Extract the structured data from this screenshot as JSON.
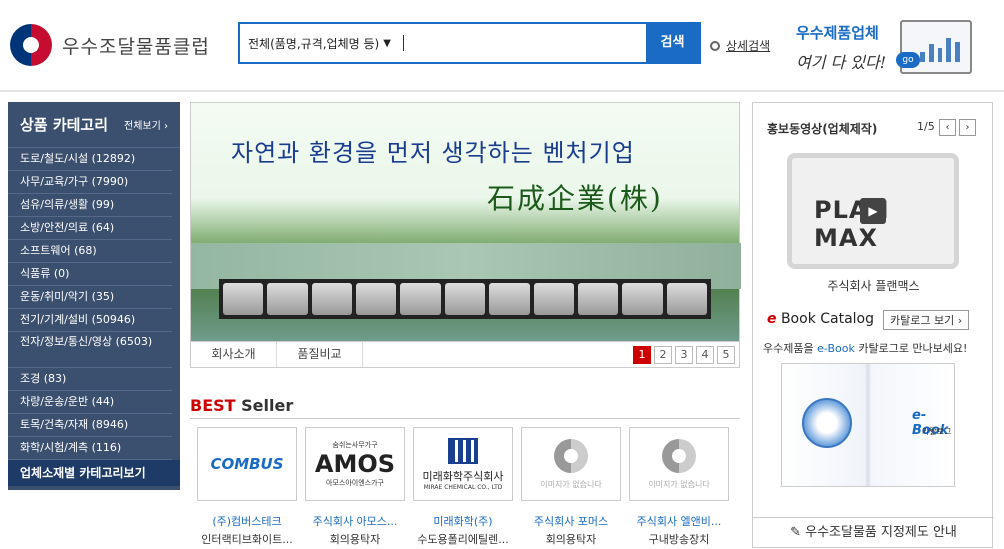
{
  "header": {
    "logo_text": "우수조달물품클럽",
    "search": {
      "scope": "전체(품명,규격,업체명 등)",
      "button": "검색",
      "advanced": "상세검색"
    },
    "promo": {
      "line1": "우수제품업체",
      "line2": "여기 다 있다!",
      "go": "go"
    }
  },
  "categories": {
    "title": "상품 카테고리",
    "view_all": "전체보기",
    "items": [
      "도로/철도/시설 (12892)",
      "사무/교육/가구 (7990)",
      "섬유/의류/생활 (99)",
      "소방/안전/의료 (64)",
      "소프트웨어 (68)",
      "식품류 (0)",
      "운동/취미/악기 (35)",
      "전기/기계/설비 (50946)",
      "전자/정보/통신/영상 (6503)",
      "조경 (83)",
      "차량/운송/운반 (44)",
      "토목/건축/자재 (8946)",
      "화학/시험/계측 (116)"
    ],
    "footer": "업체소재별 카테고리보기"
  },
  "banner": {
    "headline": "자연과 환경을 먼저 생각하는 벤처기업",
    "company": "石成企業(株)",
    "tabs": [
      "회사소개",
      "품질비교"
    ],
    "pages": [
      "1",
      "2",
      "3",
      "4",
      "5"
    ],
    "active_page": "1"
  },
  "best_seller": {
    "title_red": "BEST",
    "title_rest": " Seller",
    "items": [
      {
        "company": "(주)컴버스테크",
        "product": "인터랙티브화이트...",
        "logo": "COMBUS"
      },
      {
        "company": "주식회사 아모스...",
        "product": "회의용탁자",
        "logo": "AMOS",
        "logo_sub": "아모스아이엔스가구",
        "logo_top": "숨쉬는사무가구"
      },
      {
        "company": "미래화학(주)",
        "product": "수도용폴리에틸렌...",
        "logo": "미래화학주식회사",
        "logo_sub": "MIRAE CHEMICAL CO., LTD"
      },
      {
        "company": "주식회사 포머스",
        "product": "회의용탁자",
        "noimg": "이미지가 없습니다"
      },
      {
        "company": "주식회사 엘앤비...",
        "product": "구내방송장치",
        "noimg": "이미지가 없습니다"
      }
    ]
  },
  "right": {
    "video_title": "홍보동영상(업체제작)",
    "video_page": "1/5",
    "video_brand": "PLAN MAX",
    "video_company": "주식회사 플랜맥스",
    "ebook_title": "Book Catalog",
    "ebook_e": "e",
    "catalog_button": "카탈로그 보기",
    "ebook_msg_pre": "우수제품을 ",
    "ebook_msg_link": "e-Book",
    "ebook_msg_post": " 카탈로그로  만나보세요!",
    "ebook_label": "e-Book",
    "ebook_sub": "카탈로그",
    "designation": "우수조달물품 지정제도 안내"
  }
}
